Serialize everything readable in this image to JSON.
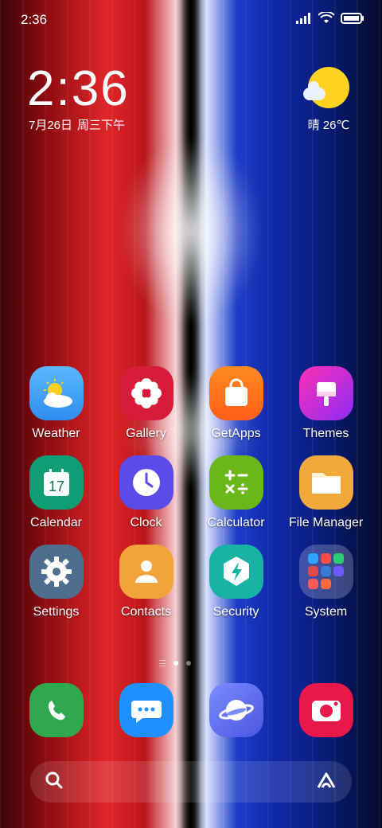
{
  "status_bar": {
    "time": "2:36",
    "icons": [
      "signal-icon",
      "wifi-icon",
      "battery-icon"
    ]
  },
  "lock_clock": {
    "time": "2:36",
    "date": "7月26日",
    "weekday": "周三下午"
  },
  "weather": {
    "text": "晴 26℃",
    "icon": "sunny-cloud-icon"
  },
  "apps": [
    {
      "label": "Weather",
      "icon": "weather-icon"
    },
    {
      "label": "Gallery",
      "icon": "gallery-icon"
    },
    {
      "label": "GetApps",
      "icon": "getapps-icon"
    },
    {
      "label": "Themes",
      "icon": "themes-icon"
    },
    {
      "label": "Calendar",
      "icon": "calendar-icon",
      "badge": "17"
    },
    {
      "label": "Clock",
      "icon": "clock-icon"
    },
    {
      "label": "Calculator",
      "icon": "calculator-icon"
    },
    {
      "label": "File Manager",
      "icon": "file-manager-icon"
    },
    {
      "label": "Settings",
      "icon": "settings-icon"
    },
    {
      "label": "Contacts",
      "icon": "contacts-icon"
    },
    {
      "label": "Security",
      "icon": "security-icon"
    },
    {
      "label": "System",
      "icon": "system-folder-icon"
    }
  ],
  "dock": [
    {
      "icon": "phone-icon"
    },
    {
      "icon": "messages-icon"
    },
    {
      "icon": "browser-icon"
    },
    {
      "icon": "camera-icon"
    }
  ],
  "page_indicator": {
    "pages": 2,
    "active": 1
  },
  "search": {
    "icons": [
      "search-icon",
      "assistant-icon"
    ]
  }
}
